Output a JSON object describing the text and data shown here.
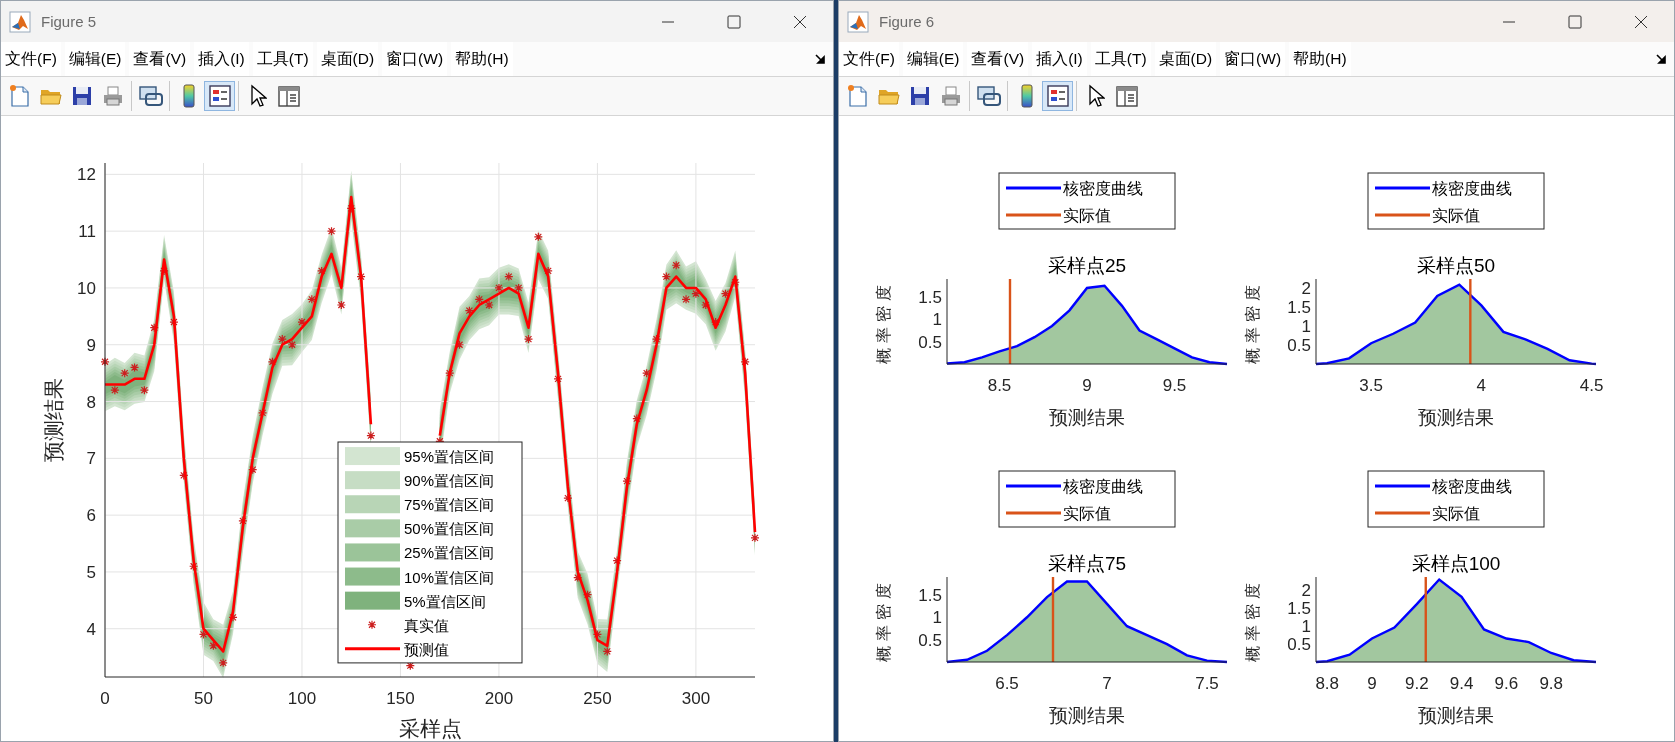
{
  "windows": [
    {
      "title": "Figure 5",
      "menu": [
        "文件(F)",
        "编辑(E)",
        "查看(V)",
        "插入(I)",
        "工具(T)",
        "桌面(D)",
        "窗口(W)",
        "帮助(H)"
      ],
      "toolbar": [
        [
          {
            "kind": "new",
            "selected": false
          },
          {
            "kind": "open",
            "selected": false
          },
          {
            "kind": "save",
            "selected": false
          },
          {
            "kind": "print",
            "selected": false
          }
        ],
        [
          {
            "kind": "link",
            "selected": false
          }
        ],
        [
          {
            "kind": "colorbar",
            "selected": false
          },
          {
            "kind": "legend",
            "selected": true
          }
        ],
        [
          {
            "kind": "pointer",
            "selected": false
          },
          {
            "kind": "inspector",
            "selected": false
          }
        ]
      ],
      "axes": [
        {
          "bands": [
            {
              "label": "95%置信区间",
              "color": "#d3e5d1"
            },
            {
              "label": "90%置信区间",
              "color": "#c6ddc4"
            },
            {
              "label": "75%置信区间",
              "color": "#b8d5b6"
            },
            {
              "label": "50%置信区间",
              "color": "#a9cca7"
            },
            {
              "label": "25%置信区间",
              "color": "#9bc499"
            },
            {
              "label": "10%置信区间",
              "color": "#8dbb8b"
            },
            {
              "label": "5%置信区间",
              "color": "#7fb27d"
            }
          ],
          "chart_data": {
            "type": "line",
            "xlabel": "采样点",
            "ylabel": "预测结果",
            "grid": true,
            "legend": true,
            "x": [
              0,
              5,
              10,
              15,
              20,
              25,
              30,
              35,
              40,
              45,
              50,
              55,
              60,
              65,
              70,
              75,
              80,
              85,
              90,
              95,
              100,
              105,
              110,
              115,
              120,
              125,
              130,
              135,
              140,
              145,
              150,
              155,
              160,
              165,
              170,
              175,
              180,
              185,
              190,
              195,
              200,
              205,
              210,
              215,
              220,
              225,
              230,
              235,
              240,
              245,
              250,
              255,
              260,
              265,
              270,
              275,
              280,
              285,
              290,
              295,
              300,
              305,
              310,
              315,
              320,
              325,
              330
            ],
            "xlim": [
              0,
              330
            ],
            "ylim": [
              3.15,
              12.2
            ],
            "xticks": [
              0,
              50,
              100,
              150,
              200,
              250,
              300
            ],
            "yticks": [
              4,
              5,
              6,
              7,
              8,
              9,
              10,
              11,
              12
            ],
            "series": [
              {
                "name": "真实值",
                "color": "#cc1f1f",
                "type": "scatter",
                "values": [
                  8.7,
                  8.2,
                  8.5,
                  8.6,
                  8.2,
                  9.3,
                  10.3,
                  9.4,
                  6.7,
                  5.1,
                  3.9,
                  3.7,
                  3.4,
                  4.2,
                  5.9,
                  6.8,
                  7.8,
                  8.7,
                  9.1,
                  9.0,
                  9.4,
                  9.8,
                  10.3,
                  11.0,
                  9.7,
                  11.4,
                  10.2,
                  7.4,
                  null,
                  null,
                  null,
                  3.35,
                  null,
                  null,
                  7.3,
                  8.5,
                  9.0,
                  9.6,
                  9.8,
                  9.7,
                  10.0,
                  10.2,
                  10.0,
                  9.1,
                  10.9,
                  10.3,
                  8.4,
                  6.3,
                  4.9,
                  4.6,
                  3.9,
                  3.6,
                  5.2,
                  6.6,
                  7.7,
                  8.5,
                  9.1,
                  10.2,
                  10.4,
                  9.8,
                  9.9,
                  9.7,
                  9.4,
                  9.9,
                  10.1,
                  8.7,
                  5.6
                ]
              },
              {
                "name": "预测值",
                "color": "#ff0000",
                "type": "line",
                "values": [
                  8.3,
                  8.3,
                  8.3,
                  8.4,
                  8.4,
                  9.0,
                  10.5,
                  9.5,
                  7.0,
                  5.2,
                  4.0,
                  3.8,
                  3.6,
                  4.3,
                  5.8,
                  7.0,
                  7.8,
                  8.6,
                  9.0,
                  9.1,
                  9.3,
                  9.5,
                  10.2,
                  10.6,
                  10.0,
                  11.6,
                  10.2,
                  7.6,
                  null,
                  null,
                  null,
                  null,
                  null,
                  null,
                  7.4,
                  8.5,
                  9.2,
                  9.5,
                  9.7,
                  9.8,
                  9.9,
                  10.0,
                  9.9,
                  9.3,
                  10.6,
                  10.2,
                  8.5,
                  6.5,
                  5.0,
                  4.5,
                  3.8,
                  3.7,
                  5.0,
                  6.5,
                  7.6,
                  8.2,
                  9.0,
                  10.0,
                  10.2,
                  10.0,
                  10.0,
                  9.8,
                  9.3,
                  9.7,
                  10.2,
                  8.5,
                  5.7
                ]
              }
            ]
          }
        }
      ]
    },
    {
      "title": "Figure 6",
      "menu": [
        "文件(F)",
        "编辑(E)",
        "查看(V)",
        "插入(I)",
        "工具(T)",
        "桌面(D)",
        "窗口(W)",
        "帮助(H)"
      ],
      "toolbar": [
        [
          {
            "kind": "new",
            "selected": false
          },
          {
            "kind": "open",
            "selected": false
          },
          {
            "kind": "save",
            "selected": false
          },
          {
            "kind": "print",
            "selected": false
          }
        ],
        [
          {
            "kind": "link",
            "selected": false
          }
        ],
        [
          {
            "kind": "colorbar",
            "selected": false
          },
          {
            "kind": "legend",
            "selected": true
          }
        ],
        [
          {
            "kind": "pointer",
            "selected": false
          },
          {
            "kind": "inspector",
            "selected": false
          }
        ]
      ],
      "axes": [
        {
          "chart_data": {
            "type": "area",
            "title": "采样点25",
            "xlabel": "预测结果",
            "ylabel": "概率密度",
            "legend": true,
            "x": [
              8.2,
              8.3,
              8.4,
              8.5,
              8.6,
              8.7,
              8.8,
              8.9,
              9.0,
              9.1,
              9.2,
              9.3,
              9.4,
              9.5,
              9.6,
              9.7,
              9.8
            ],
            "xlim": [
              8.2,
              9.8
            ],
            "ylim": [
              0,
              1.9
            ],
            "xticks": [
              8.5,
              9,
              9.5
            ],
            "yticks": [
              0.5,
              1,
              1.5
            ],
            "series": [
              {
                "name": "核密度曲线",
                "color": "#0000ff",
                "values": [
                  0.01,
                  0.04,
                  0.15,
                  0.28,
                  0.4,
                  0.6,
                  0.85,
                  1.2,
                  1.7,
                  1.75,
                  1.3,
                  0.75,
                  0.55,
                  0.35,
                  0.15,
                  0.04,
                  0.0
                ]
              }
            ],
            "ref_lines": [
              {
                "axis": "x",
                "value": 8.56,
                "label": "实际值",
                "color": "#d95319"
              }
            ]
          }
        },
        {
          "chart_data": {
            "type": "area",
            "title": "采样点50",
            "xlabel": "预测结果",
            "ylabel": "概率密度",
            "legend": true,
            "x": [
              3.25,
              3.3,
              3.4,
              3.5,
              3.6,
              3.7,
              3.8,
              3.9,
              4.0,
              4.1,
              4.2,
              4.3,
              4.4,
              4.5,
              4.52
            ],
            "xlim": [
              3.25,
              4.52
            ],
            "ylim": [
              0,
              2.25
            ],
            "xticks": [
              3.5,
              4,
              4.5
            ],
            "yticks": [
              0.5,
              1,
              1.5,
              2
            ],
            "series": [
              {
                "name": "核密度曲线",
                "color": "#0000ff",
                "values": [
                  0.0,
                  0.02,
                  0.15,
                  0.55,
                  0.8,
                  1.1,
                  1.8,
                  2.1,
                  1.55,
                  0.85,
                  0.65,
                  0.4,
                  0.1,
                  0.01,
                  0.0
                ]
              }
            ],
            "ref_lines": [
              {
                "axis": "x",
                "value": 3.95,
                "label": "实际值",
                "color": "#d95319"
              }
            ]
          }
        },
        {
          "chart_data": {
            "type": "area",
            "title": "采样点75",
            "xlabel": "预测结果",
            "ylabel": "概率密度",
            "legend": true,
            "x": [
              6.2,
              6.3,
              6.4,
              6.5,
              6.6,
              6.7,
              6.8,
              6.9,
              7.0,
              7.1,
              7.2,
              7.3,
              7.4,
              7.5,
              7.6
            ],
            "xlim": [
              6.2,
              7.6
            ],
            "ylim": [
              0,
              1.9
            ],
            "xticks": [
              6.5,
              7,
              7.5
            ],
            "yticks": [
              0.5,
              1,
              1.5
            ],
            "series": [
              {
                "name": "核密度曲线",
                "color": "#0000ff",
                "values": [
                  0.0,
                  0.05,
                  0.25,
                  0.6,
                  1.0,
                  1.45,
                  1.8,
                  1.8,
                  1.3,
                  0.8,
                  0.6,
                  0.4,
                  0.15,
                  0.03,
                  0.0
                ]
              }
            ],
            "ref_lines": [
              {
                "axis": "x",
                "value": 6.73,
                "label": "实际值",
                "color": "#d95319"
              }
            ]
          }
        },
        {
          "chart_data": {
            "type": "area",
            "title": "采样点100",
            "xlabel": "预测结果",
            "ylabel": "概率密度",
            "legend": true,
            "x": [
              8.75,
              8.8,
              8.9,
              9.0,
              9.1,
              9.2,
              9.3,
              9.4,
              9.5,
              9.6,
              9.7,
              9.8,
              9.9,
              10.0
            ],
            "xlim": [
              8.75,
              10.0
            ],
            "ylim": [
              0,
              2.35
            ],
            "xticks": [
              8.8,
              9,
              9.2,
              9.4,
              9.6,
              9.8
            ],
            "yticks": [
              0.5,
              1,
              1.5,
              2
            ],
            "series": [
              {
                "name": "核密度曲线",
                "color": "#0000ff",
                "values": [
                  0.0,
                  0.02,
                  0.2,
                  0.65,
                  0.95,
                  1.6,
                  2.28,
                  1.8,
                  0.9,
                  0.65,
                  0.55,
                  0.25,
                  0.05,
                  0.0
                ]
              }
            ],
            "ref_lines": [
              {
                "axis": "x",
                "value": 9.24,
                "label": "实际值",
                "color": "#d95319"
              }
            ]
          }
        }
      ]
    }
  ]
}
